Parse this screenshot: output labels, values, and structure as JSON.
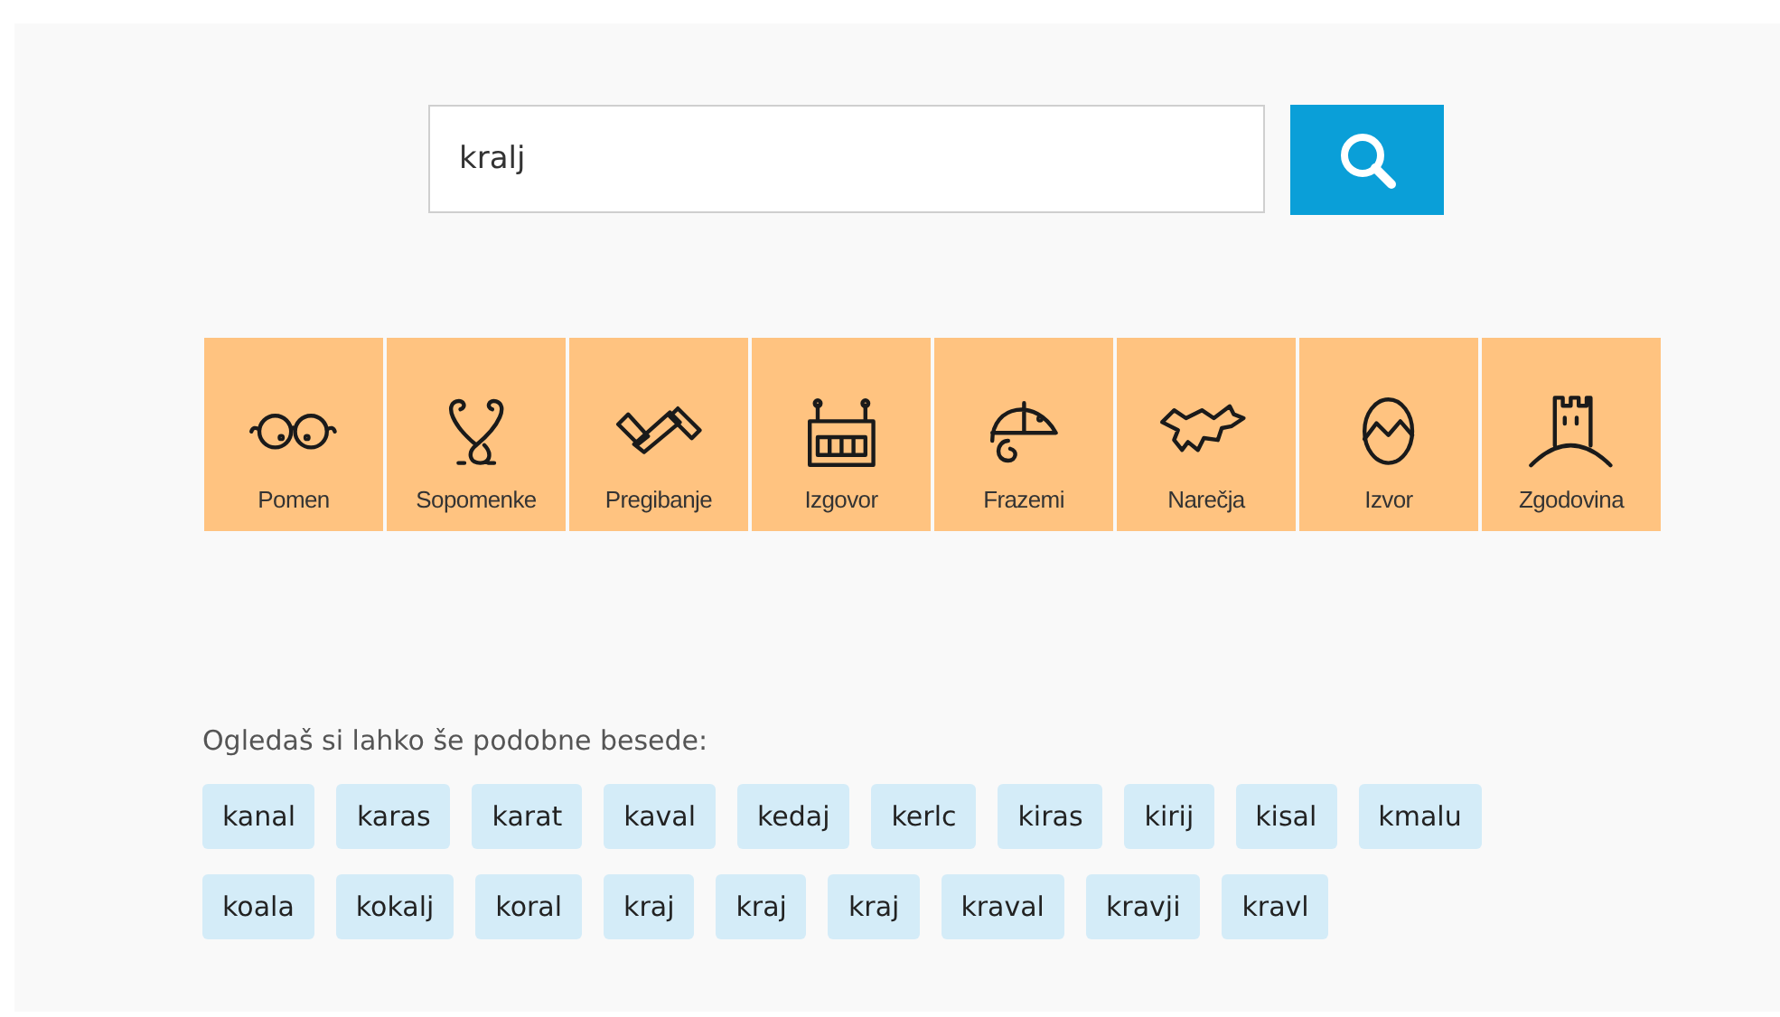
{
  "search": {
    "value": "kralj"
  },
  "categories": [
    {
      "label": "Pomen"
    },
    {
      "label": "Sopomenke"
    },
    {
      "label": "Pregibanje"
    },
    {
      "label": "Izgovor"
    },
    {
      "label": "Frazemi"
    },
    {
      "label": "Narečja"
    },
    {
      "label": "Izvor"
    },
    {
      "label": "Zgodovina"
    }
  ],
  "similar": {
    "heading": "Ogledaš si lahko še podobne besede:",
    "rows": [
      [
        "kanal",
        "karas",
        "karat",
        "kaval",
        "kedaj",
        "kerlc",
        "kiras",
        "kirij",
        "kisal",
        "kmalu"
      ],
      [
        "koala",
        "kokalj",
        "koral",
        "kraj",
        "kraj",
        "kraj",
        "kraval",
        "kravji",
        "kravl"
      ]
    ]
  }
}
